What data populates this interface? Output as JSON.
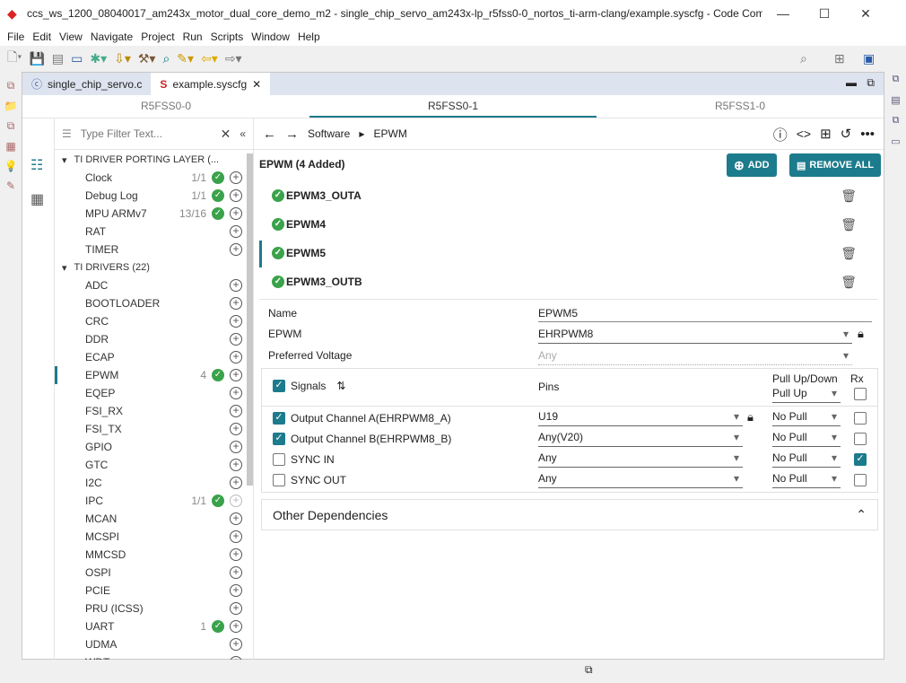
{
  "window": {
    "title": "ccs_ws_1200_08040017_am243x_motor_dual_core_demo_m2 - single_chip_servo_am243x-lp_r5fss0-0_nortos_ti-arm-clang/example.syscfg - Code Composer S...",
    "minimize": "—",
    "maximize": "☐",
    "close": "✕"
  },
  "menu": [
    "File",
    "Edit",
    "View",
    "Navigate",
    "Project",
    "Run",
    "Scripts",
    "Window",
    "Help"
  ],
  "editor_tabs": [
    {
      "label": "single_chip_servo.c"
    },
    {
      "label": "example.syscfg",
      "close": "✕"
    }
  ],
  "core_tabs": [
    "R5FSS0-0",
    "R5FSS0-1",
    "R5FSS1-0"
  ],
  "filter": {
    "placeholder": "Type Filter Text..."
  },
  "tree": {
    "groups": [
      {
        "label": "TI DRIVER PORTING LAYER (...",
        "items": [
          {
            "label": "Clock",
            "count": "1/1",
            "ok": true
          },
          {
            "label": "Debug Log",
            "count": "1/1",
            "ok": true
          },
          {
            "label": "MPU ARMv7",
            "count": "13/16",
            "ok": true
          },
          {
            "label": "RAT",
            "count": ""
          },
          {
            "label": "TIMER",
            "count": ""
          }
        ]
      },
      {
        "label": "TI DRIVERS (22)",
        "items": [
          {
            "label": "ADC",
            "count": ""
          },
          {
            "label": "BOOTLOADER",
            "count": ""
          },
          {
            "label": "CRC",
            "count": ""
          },
          {
            "label": "DDR",
            "count": ""
          },
          {
            "label": "ECAP",
            "count": ""
          },
          {
            "label": "EPWM",
            "count": "4",
            "ok": true,
            "selected": true
          },
          {
            "label": "EQEP",
            "count": ""
          },
          {
            "label": "FSI_RX",
            "count": ""
          },
          {
            "label": "FSI_TX",
            "count": ""
          },
          {
            "label": "GPIO",
            "count": ""
          },
          {
            "label": "GTC",
            "count": ""
          },
          {
            "label": "I2C",
            "count": ""
          },
          {
            "label": "IPC",
            "count": "1/1",
            "ok": true,
            "disabled": true
          },
          {
            "label": "MCAN",
            "count": ""
          },
          {
            "label": "MCSPI",
            "count": ""
          },
          {
            "label": "MMCSD",
            "count": ""
          },
          {
            "label": "OSPI",
            "count": ""
          },
          {
            "label": "PCIE",
            "count": ""
          },
          {
            "label": "PRU (ICSS)",
            "count": ""
          },
          {
            "label": "UART",
            "count": "1",
            "ok": true
          },
          {
            "label": "UDMA",
            "count": ""
          },
          {
            "label": "WDT",
            "count": ""
          }
        ]
      }
    ]
  },
  "breadcrumb": [
    "Software",
    "EPWM"
  ],
  "module": {
    "title": "EPWM (4 Added)",
    "add": "ADD",
    "remove_all": "REMOVE ALL",
    "instances": [
      "EPWM3_OUTA",
      "EPWM4",
      "EPWM5",
      "EPWM3_OUTB"
    ],
    "selected": "EPWM5"
  },
  "config": {
    "name_label": "Name",
    "name_value": "EPWM5",
    "epwm_label": "EPWM",
    "epwm_value": "EHRPWM8",
    "voltage_label": "Preferred Voltage",
    "voltage_value": "Any"
  },
  "signals": {
    "header": "Signals",
    "pins_header": "Pins",
    "pull_header": "Pull Up/Down",
    "pull_all": "Pull Up",
    "rx_header": "Rx",
    "rows": [
      {
        "name": "Output Channel A(EHRPWM8_A)",
        "checked": true,
        "pin": "U19",
        "locked": true,
        "pull": "No Pull",
        "rx": false
      },
      {
        "name": "Output Channel B(EHRPWM8_B)",
        "checked": true,
        "pin": "Any(V20)",
        "pull": "No Pull",
        "rx": false
      },
      {
        "name": "SYNC IN",
        "checked": false,
        "pin": "Any",
        "pull": "No Pull",
        "rx": true
      },
      {
        "name": "SYNC OUT",
        "checked": false,
        "pin": "Any",
        "pull": "No Pull",
        "rx": false
      }
    ]
  },
  "other_dependencies": "Other Dependencies",
  "colors": {
    "accent": "#1c7b8c",
    "ok": "#3aa24a"
  }
}
